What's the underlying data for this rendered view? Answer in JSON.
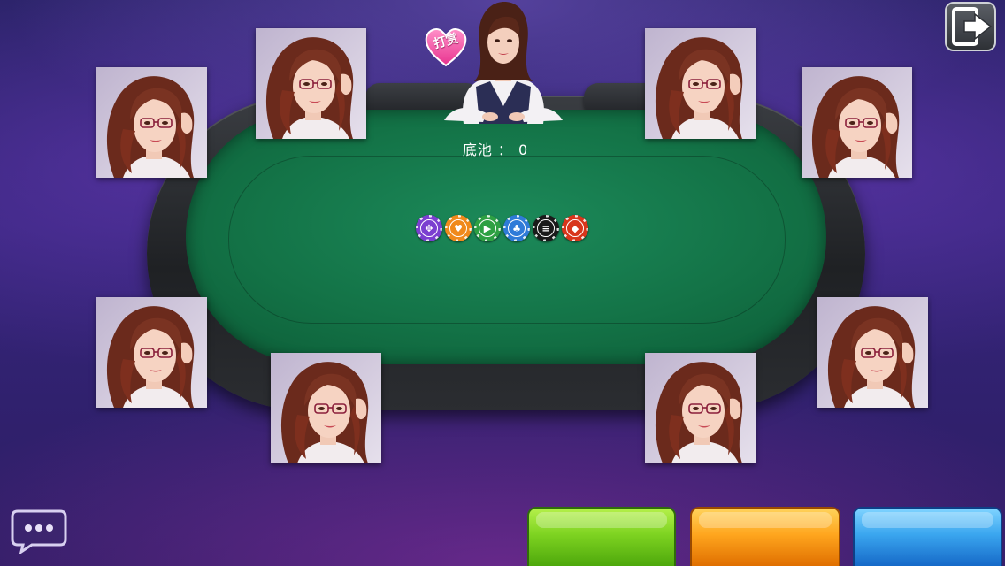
{
  "dealer": {
    "tip_label": "打赏"
  },
  "pot": {
    "text": "底池 ： 0"
  },
  "chips": [
    {
      "color": "#7b3fd0",
      "icon": "diamond-dots-icon",
      "glyph": "✥"
    },
    {
      "color": "#f08a1c",
      "icon": "heart-icon",
      "glyph": "♥"
    },
    {
      "color": "#2ea043",
      "icon": "play-icon",
      "glyph": "▶"
    },
    {
      "color": "#2f7bd8",
      "icon": "club-icon",
      "glyph": "♣"
    },
    {
      "color": "#1a1a1a",
      "icon": "bars-icon",
      "glyph": "≡"
    },
    {
      "color": "#d8361c",
      "icon": "diamond-icon",
      "glyph": "◆"
    }
  ],
  "players": [
    {
      "seat": 1
    },
    {
      "seat": 2
    },
    {
      "seat": 3
    },
    {
      "seat": 4
    },
    {
      "seat": 5
    },
    {
      "seat": 6
    },
    {
      "seat": 7
    },
    {
      "seat": 8
    }
  ],
  "colors": {
    "felt": "#137246",
    "rail": "#2b2d31",
    "background": "#35257a",
    "action_green": "#7ed321",
    "action_orange": "#ffa61e",
    "action_blue": "#3aa6ef"
  },
  "icons": {
    "exit": "exit-door-icon",
    "chat": "chat-bubble-icon",
    "tip": "heart-icon"
  }
}
